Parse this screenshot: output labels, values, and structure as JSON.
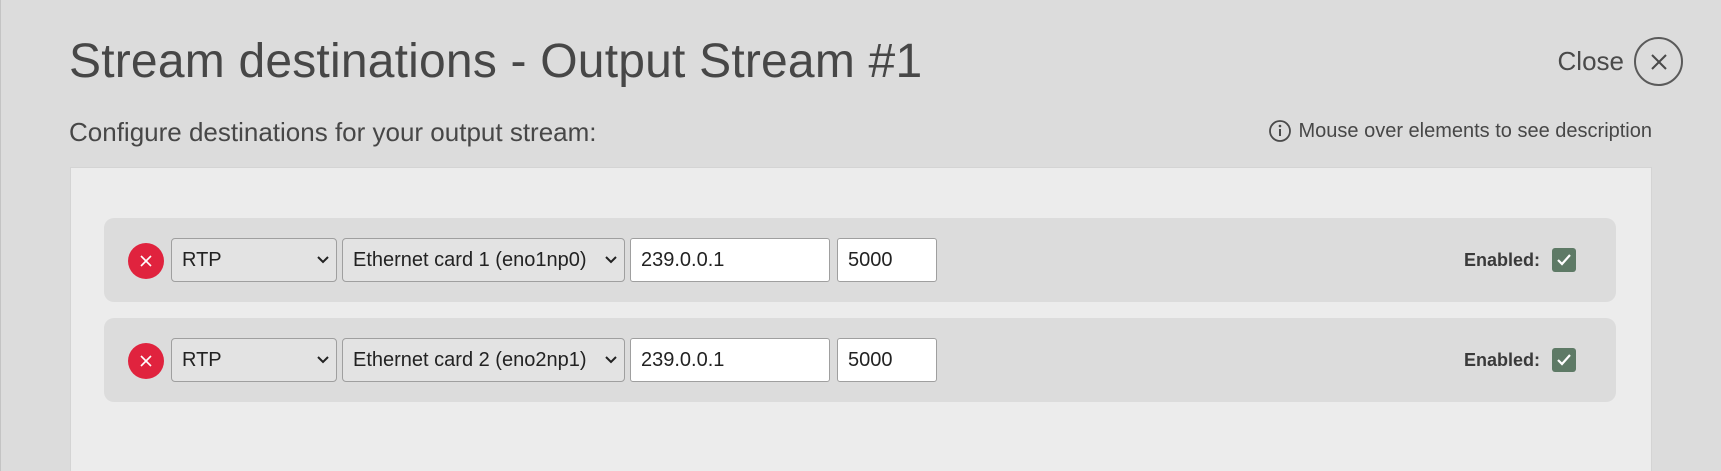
{
  "modal": {
    "title": "Stream destinations - Output Stream #1",
    "close_label": "Close",
    "subtitle": "Configure destinations for your output stream:",
    "hint": "Mouse over elements to see description"
  },
  "destinations": [
    {
      "protocol": "RTP",
      "interface": "Ethernet card 1 (eno1np0)",
      "address": "239.0.0.1",
      "port": "5000",
      "enabled_label": "Enabled:",
      "enabled": true
    },
    {
      "protocol": "RTP",
      "interface": "Ethernet card 2 (eno2np1)",
      "address": "239.0.0.1",
      "port": "5000",
      "enabled_label": "Enabled:",
      "enabled": true
    }
  ],
  "icons": {
    "close": "close-icon",
    "info": "info-icon",
    "remove": "remove-icon",
    "chevron": "chevron-down-icon",
    "check": "checkmark-icon"
  },
  "colors": {
    "background": "#dcdcdc",
    "panel": "#ececec",
    "remove_button": "#e0233e",
    "checkbox": "#5e7a66"
  }
}
